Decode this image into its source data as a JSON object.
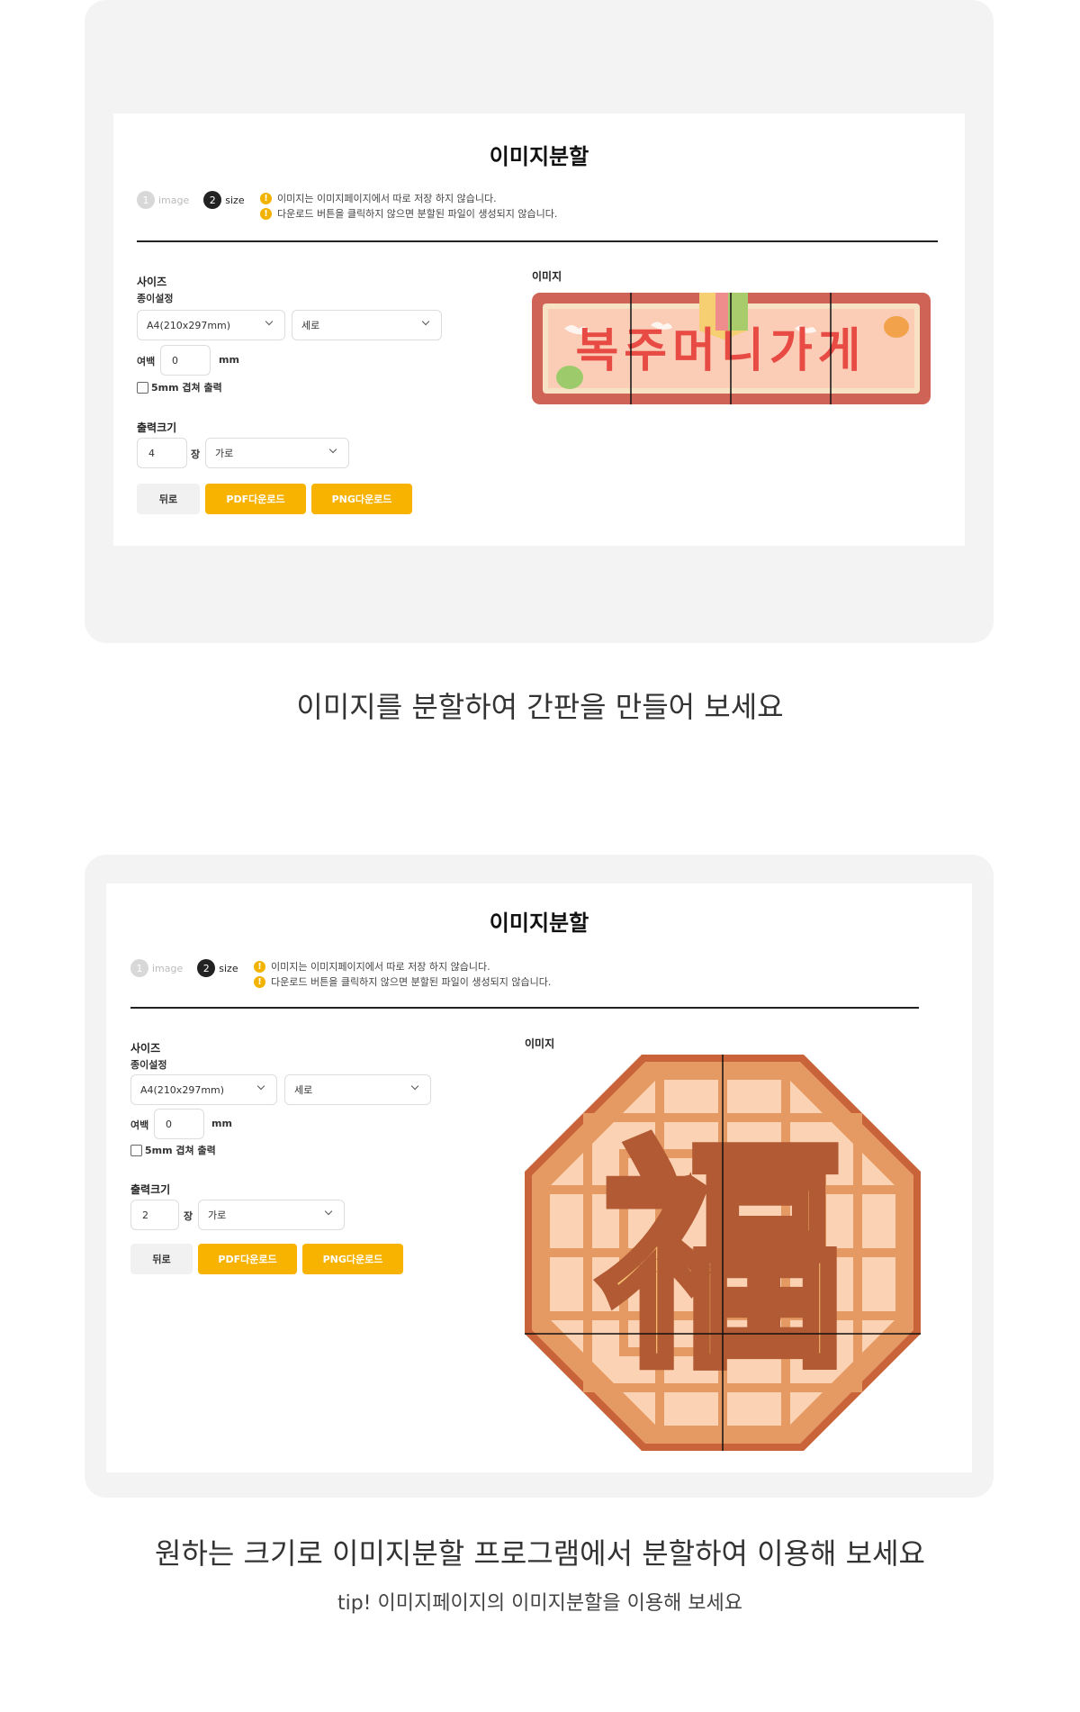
{
  "examples": [
    {
      "title": "이미지분할",
      "steps": [
        {
          "num": "1",
          "label": "image"
        },
        {
          "num": "2",
          "label": "size"
        }
      ],
      "notices": [
        "이미지는 이미지페이지에서 따로 저장 하지 않습니다.",
        "다운로드 버튼을 클릭하지 않으면 분할된 파일이 생성되지 않습니다."
      ],
      "size_label": "사이즈",
      "paper_label": "종이설정",
      "paper_select": "A4(210x297mm)",
      "orientation_select": "세로",
      "margin_label": "여백",
      "margin_value": "0",
      "margin_unit": "mm",
      "overlap_label": "5mm 겹쳐 출력",
      "output_label": "출력크기",
      "sheets_value": "4",
      "sheets_unit": "장",
      "direction_select": "가로",
      "back_button": "뒤로",
      "pdf_button": "PDF다운로드",
      "png_button": "PNG다운로드",
      "image_label": "이미지",
      "image_text": "복주머니가게"
    },
    {
      "title": "이미지분할",
      "steps": [
        {
          "num": "1",
          "label": "image"
        },
        {
          "num": "2",
          "label": "size"
        }
      ],
      "notices": [
        "이미지는 이미지페이지에서 따로 저장 하지 않습니다.",
        "다운로드 버튼을 클릭하지 않으면 분할된 파일이 생성되지 않습니다."
      ],
      "size_label": "사이즈",
      "paper_label": "종이설정",
      "paper_select": "A4(210x297mm)",
      "orientation_select": "세로",
      "margin_label": "여백",
      "margin_value": "0",
      "margin_unit": "mm",
      "overlap_label": "5mm 겹쳐 출력",
      "output_label": "출력크기",
      "sheets_value": "2",
      "sheets_unit": "장",
      "direction_select": "가로",
      "back_button": "뒤로",
      "pdf_button": "PDF다운로드",
      "png_button": "PNG다운로드",
      "image_label": "이미지",
      "image_text": "福"
    }
  ],
  "captions": {
    "first": "이미지를 분할하여 간판을 만들어 보세요",
    "second": "원하는 크기로 이미지분할 프로그램에서 분할하여 이용해 보세요",
    "tip": "tip! 이미지페이지의 이미지분할을 이용해 보세요"
  },
  "colors": {
    "accent": "#f7b300",
    "warning": "#f2b200"
  }
}
